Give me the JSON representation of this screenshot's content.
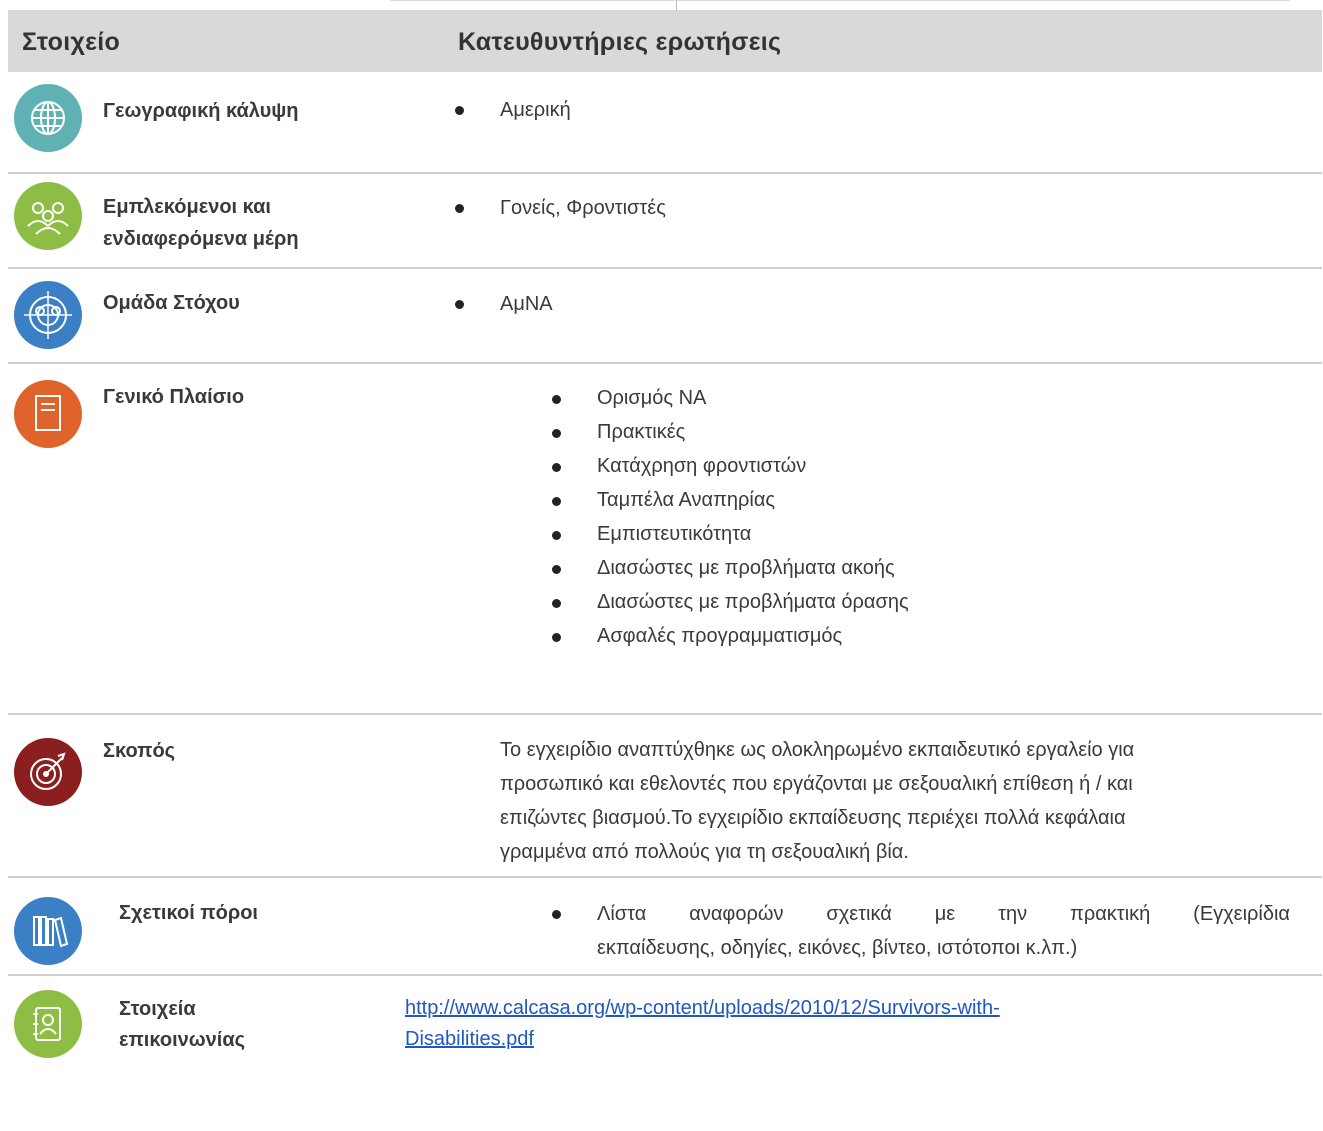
{
  "header": {
    "col1": "Στοιχείο",
    "col2": "Κατευθυντήριες ερωτήσεις"
  },
  "rows": {
    "geo": {
      "label": "Γεωγραφική κάλυψη",
      "items": [
        "Αμερική"
      ],
      "icon": "globe-icon",
      "color": "#5fb1b3"
    },
    "stake": {
      "label_1": "Εμπλεκόμενοι και",
      "label_2": "ενδιαφερόμενα μέρη",
      "items": [
        "Γονείς, Φροντιστές"
      ],
      "icon": "people-group-icon",
      "color": "#8dbd45"
    },
    "target": {
      "label": "Ομάδα Στόχου",
      "items": [
        "ΑμΝΑ"
      ],
      "icon": "target-group-icon",
      "color": "#3b7fc4"
    },
    "context": {
      "label": "Γενικό Πλαίσιο",
      "icon": "document-icon",
      "color": "#e0632b",
      "items": [
        "Ορισμός ΝΑ",
        "Πρακτικές",
        "Κατάχρηση φροντιστών",
        "Ταμπέλα Αναπηρίας",
        "Εμπιστευτικότητα",
        "Διασώστες με προβλήματα ακοής",
        "Διασώστες με προβλήματα όρασης",
        "Ασφαλές προγραμματισμός"
      ]
    },
    "purpose": {
      "label": "Σκοπός",
      "icon": "bullseye-icon",
      "color": "#8b1e1e",
      "lines": [
        "Το εγχειρίδιο αναπτύχθηκε ως ολοκληρωμένο εκπαιδευτικό εργαλείο για",
        "προσωπικό και εθελοντές που εργάζονται με σεξουαλική επίθεση ή / και",
        "επιζώντες βιασμού.Το εγχειρίδιο εκπαίδευσης περιέχει πολλά κεφάλαια",
        "γραμμένα από πολλούς για τη σεξουαλική βία."
      ]
    },
    "resources": {
      "label": "Σχετικοί πόροι",
      "icon": "books-icon",
      "color": "#3b7fc4",
      "line_1": "Λίστα αναφορών σχετικά με την πρακτική (Εγχειρίδια",
      "line_2": "εκπαίδευσης, οδηγίες, εικόνες, βίντεο, ιστότοποι κ.λπ.)"
    },
    "contact": {
      "label_1": "Στοιχεία",
      "label_2": "επικοινωνίας",
      "icon": "contact-book-icon",
      "color": "#8dbd45",
      "link_1": "http://www.calcasa.org/wp-content/uploads/2010/12/Survivors-with-",
      "link_2": "Disabilities.pdf"
    }
  }
}
